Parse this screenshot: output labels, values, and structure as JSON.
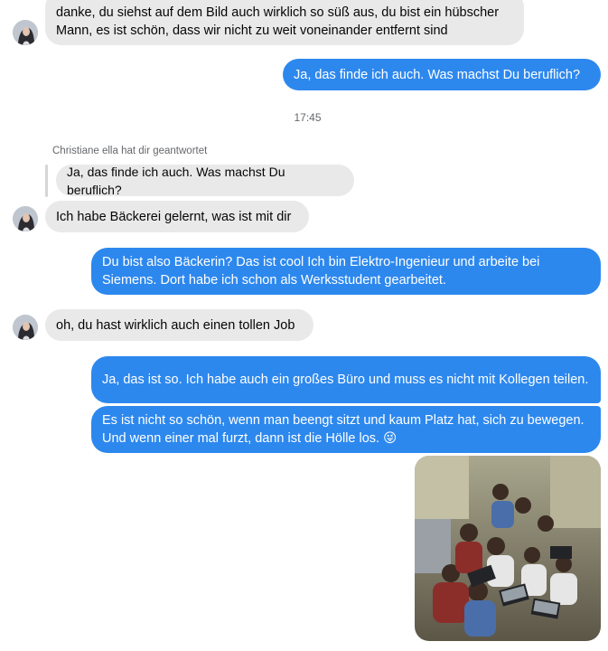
{
  "messages": [
    {
      "text": "danke, du siehst auf dem Bild auch wirklich so süß aus, du bist ein hübscher Mann, es ist schön, dass wir nicht zu weit voneinander entfernt sind"
    },
    {
      "text": "Ja, das finde ich auch. Was machst Du beruflich?"
    },
    {
      "text": "Ich habe Bäckerei gelernt, was ist mit dir"
    },
    {
      "text": "Du bist also Bäckerin? Das ist cool Ich bin Elektro-Ingenieur und arbeite bei Siemens. Dort habe ich schon als Werksstudent gearbeitet."
    },
    {
      "text": "oh, du hast wirklich auch einen tollen Job"
    },
    {
      "text": "Ja, das ist so. Ich habe auch ein großes Büro und muss es nicht mit Kollegen teilen."
    },
    {
      "text": "Es ist nicht so schön, wenn man beengt sitzt und kaum Platz hat, sich zu bewegen. Und wenn einer mal furzt, dann ist die Hölle los. 😜"
    }
  ],
  "timestamp": "17:45",
  "reply": {
    "note": "Christiane ella hat dir geantwortet",
    "quoted": "Ja, das finde ich auch. Was machst Du beruflich?"
  },
  "colors": {
    "outgoing": "#2d88ee",
    "incoming": "#e9e9ea"
  },
  "icons": {
    "avatar": "contact-avatar"
  }
}
